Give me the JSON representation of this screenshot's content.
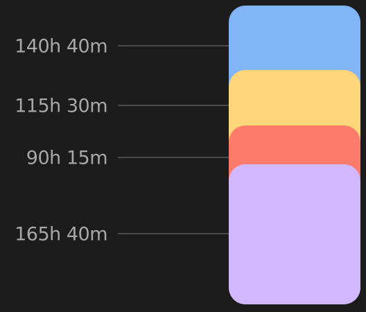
{
  "categories": [
    {
      "label": "140h 40m",
      "color": "#82b4f8",
      "hours": 140.67
    },
    {
      "label": "115h 30m",
      "color": "#ffd67a",
      "hours": 115.5
    },
    {
      "label": "90h 15m",
      "color": "#fd7b6b",
      "hours": 90.25
    },
    {
      "label": "165h 40m",
      "color": "#d2b9ff",
      "hours": 165.67
    }
  ]
}
